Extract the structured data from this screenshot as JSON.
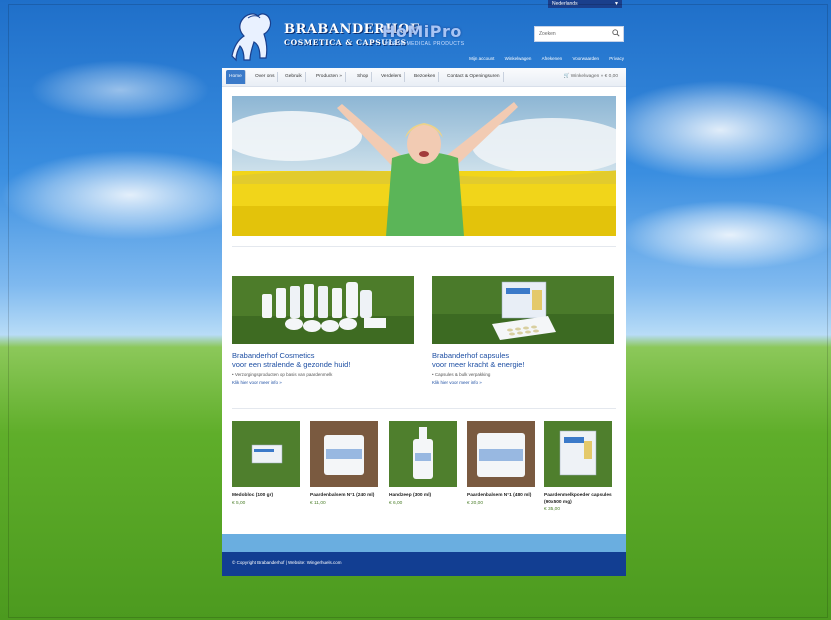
{
  "header": {
    "logo_title": "BRABANDERHOF",
    "logo_subtitle": "COSMETICA & CAPSULES",
    "partner_logo": "HoMiPro",
    "partner_sub": "HORSE MEDICAL PRODUCTS",
    "language": "Nederlands",
    "search_placeholder": "Zoeken",
    "top_links": [
      "Mijn account",
      "Winkelwagen",
      "Afrekenen",
      "Voorwaarden",
      "Privacy"
    ]
  },
  "nav": {
    "items": [
      "Home",
      "Over ons",
      "Gebruik",
      "Producten »",
      "Shop",
      "Verdelers",
      "Bezoeken",
      "Contact & Openingsuren"
    ],
    "cart_label": "Winkelwagen",
    "cart_amount": "€ 0,00"
  },
  "features": [
    {
      "title_line1": "Brabanderhof Cosmetics",
      "title_line2": "voor een stralende & gezonde huid!",
      "sub": "• Verzorgingsproducten op basis van paardenmelk",
      "more": "Klik hier voor meer info »"
    },
    {
      "title_line1": "Brabanderhof capsules",
      "title_line2": "voor meer kracht & energie!",
      "sub": "• Capsules & bulk verpakking",
      "more": "Klik hier voor meer info »"
    }
  ],
  "products": [
    {
      "name": "Medobloc (100 gr)",
      "price": "€ 5,00"
    },
    {
      "name": "Paardenbalsem N°1 (240 ml)",
      "price": "€ 11,00"
    },
    {
      "name": "Handzeep (300 ml)",
      "price": "€ 6,00"
    },
    {
      "name": "Paardenbalsem N°1 (480 ml)",
      "price": "€ 20,00"
    },
    {
      "name": "Paardenmelkpoeder capsules (90x500 mg)",
      "price": "€ 35,00"
    }
  ],
  "footer": {
    "copyright": "© Copyright Brabanderhof  |  Website: Wingerhuels.com"
  },
  "colors": {
    "brand_blue": "#1e4fa3",
    "nav_active": "#3b7ac9",
    "footer_dark": "#123e92",
    "footer_light": "#6aaee0",
    "price_green": "#4b7e2a"
  }
}
